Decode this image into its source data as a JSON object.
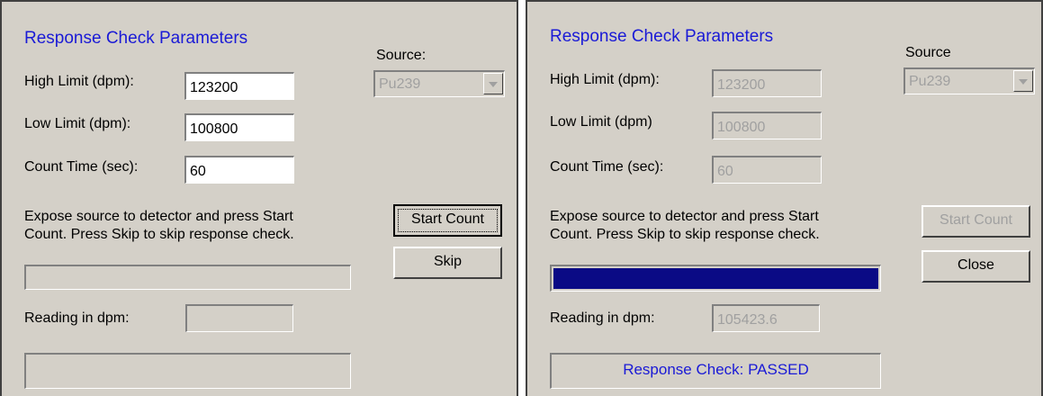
{
  "panels": [
    {
      "title": "Response Check Parameters",
      "source_label": "Source:",
      "source_value": "Pu239",
      "high_label": "High Limit (dpm):",
      "high_value": "123200",
      "low_label": "Low Limit (dpm):",
      "low_value": "100800",
      "count_label": "Count Time (sec):",
      "count_value": "60",
      "instruction_line1": "Expose source to detector and press Start",
      "instruction_line2": "Count.  Press Skip to skip response check.",
      "start_button": "Start Count",
      "secondary_button": "Skip",
      "reading_label": "Reading in dpm:",
      "reading_value": "",
      "progress": 0,
      "status": ""
    },
    {
      "title": "Response Check Parameters",
      "source_label": "Source",
      "source_value": "Pu239",
      "high_label": "High Limit (dpm):",
      "high_value": "123200",
      "low_label": "Low Limit (dpm)",
      "low_value": "100800",
      "count_label": "Count Time (sec):",
      "count_value": "60",
      "instruction_line1": "Expose source to detector and press Start",
      "instruction_line2": "Count.  Press Skip to skip response check.",
      "start_button": "Start Count",
      "secondary_button": "Close",
      "reading_label": "Reading in dpm:",
      "reading_value": "105423.6",
      "progress": 1.0,
      "status": "Response Check: PASSED"
    }
  ],
  "colors": {
    "dialog_bg": "#d4d0c8",
    "title_blue": "#1a1ad6",
    "progress_blue": "#0a0a85",
    "disabled_text": "#a0a0a0"
  }
}
